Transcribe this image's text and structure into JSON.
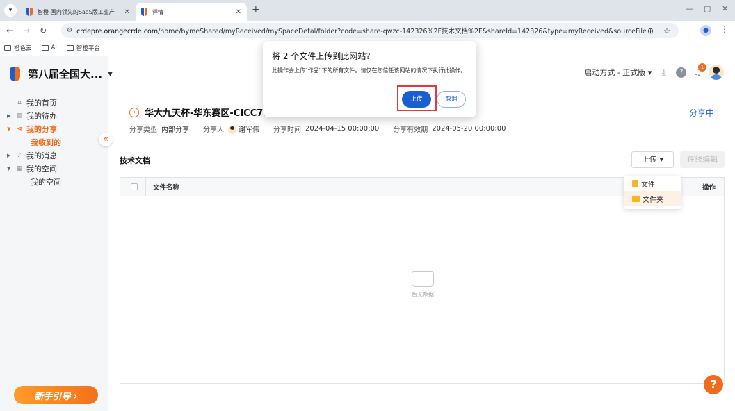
{
  "browser": {
    "tabs": [
      {
        "title": "智橙-国内领先的SaaS版工业产",
        "active": false
      },
      {
        "title": "详情",
        "active": true
      }
    ],
    "url_host": "crdepre.orangecrde.com",
    "url_path": "/home/bymeShared/myReceived/mySpaceDetal/folder?code=share-qwzc-142326%2F技术文档%2F&shareId=142326&type=myReceived&sourceFilePath=第...",
    "bookmarks": [
      "橙色云",
      "AI",
      "智橙平台"
    ]
  },
  "app": {
    "brand_name": "第八届全国大...",
    "env_label": "启动方式 - 正式版",
    "notification_count": "1"
  },
  "sidebar": {
    "items": [
      {
        "label": "我的首页",
        "icon": "home-icon"
      },
      {
        "label": "我的待办",
        "icon": "todo-icon"
      },
      {
        "label": "我的分享",
        "icon": "share-icon",
        "active": true
      },
      {
        "label": "我收到的",
        "sub": true,
        "active": true
      },
      {
        "label": "我的消息",
        "icon": "bell-icon"
      },
      {
        "label": "我的空间",
        "icon": "space-icon"
      },
      {
        "label": "我的空间",
        "sub": true
      }
    ],
    "guide_label": "新手引导 ›"
  },
  "share": {
    "title": "华大九天杯-华东赛区-CICC720",
    "status": "分享中",
    "type_label": "分享类型",
    "type_value": "内部分享",
    "sharer_label": "分享人",
    "sharer_value": "谢军伟",
    "time_label": "分享时间",
    "time_value": "2024-04-15 00:00:00",
    "expire_label": "分享有效期",
    "expire_value": "2024-05-20 00:00:00"
  },
  "section": {
    "title": "技术文档",
    "upload_label": "上传",
    "edit_label": "在线编辑"
  },
  "table": {
    "col_name": "文件名称",
    "col_op": "操作",
    "empty_text": "暂无数据"
  },
  "dropdown": {
    "items": [
      "文件",
      "文件夹"
    ]
  },
  "dialog": {
    "title": "将 2 个文件上传到此网站?",
    "body": "此操作会上传\"作品\"下的所有文件。请仅在您信任该网站的情况下执行此操作。",
    "confirm_label": "上传",
    "cancel_label": "取消"
  },
  "help_label": "?"
}
